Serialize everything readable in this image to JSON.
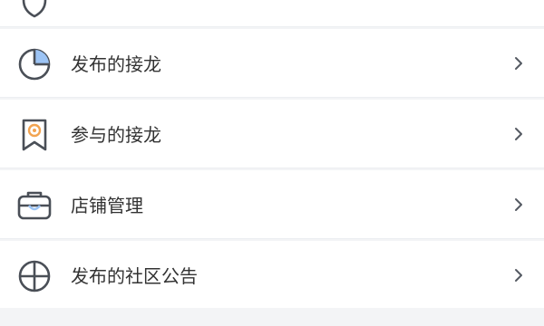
{
  "colors": {
    "icon_stroke": "#4a4f57",
    "icon_accent_blue": "#9cc4f5",
    "icon_accent_orange": "#f2a451",
    "chevron": "#555a62",
    "text": "#333333",
    "background": "#f3f4f6",
    "row_background": "#ffffff"
  },
  "menu": {
    "items": [
      {
        "label": "",
        "icon": "shield-icon"
      },
      {
        "label": "发布的接龙",
        "icon": "pie-chart-icon"
      },
      {
        "label": "参与的接龙",
        "icon": "badge-flower-icon"
      },
      {
        "label": "店铺管理",
        "icon": "briefcase-icon"
      },
      {
        "label": "发布的社区公告",
        "icon": "globe-icon"
      }
    ]
  }
}
